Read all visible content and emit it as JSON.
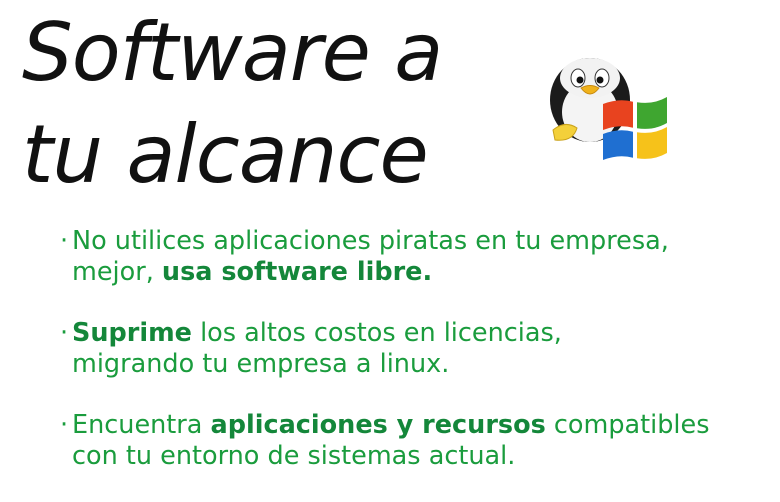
{
  "title": {
    "line1": "Software a",
    "line2": "tu alcance"
  },
  "colors": {
    "accent": "#1a9c3d",
    "title": "#111111"
  },
  "logo": {
    "icon": "penguin-with-windows-flag-icon"
  },
  "bullets": [
    {
      "pre": "No utilices aplicaciones piratas en tu empresa,",
      "line2_pre": "mejor, ",
      "bold": "usa software libre.",
      "post": ""
    },
    {
      "bold": "Suprime",
      "post": " los altos costos en licencias,",
      "line2": "migrando tu empresa a linux."
    },
    {
      "pre": "Encuentra ",
      "bold": "aplicaciones y recursos",
      "post": " compatibles",
      "line2": "con tu entorno de sistemas actual."
    }
  ]
}
